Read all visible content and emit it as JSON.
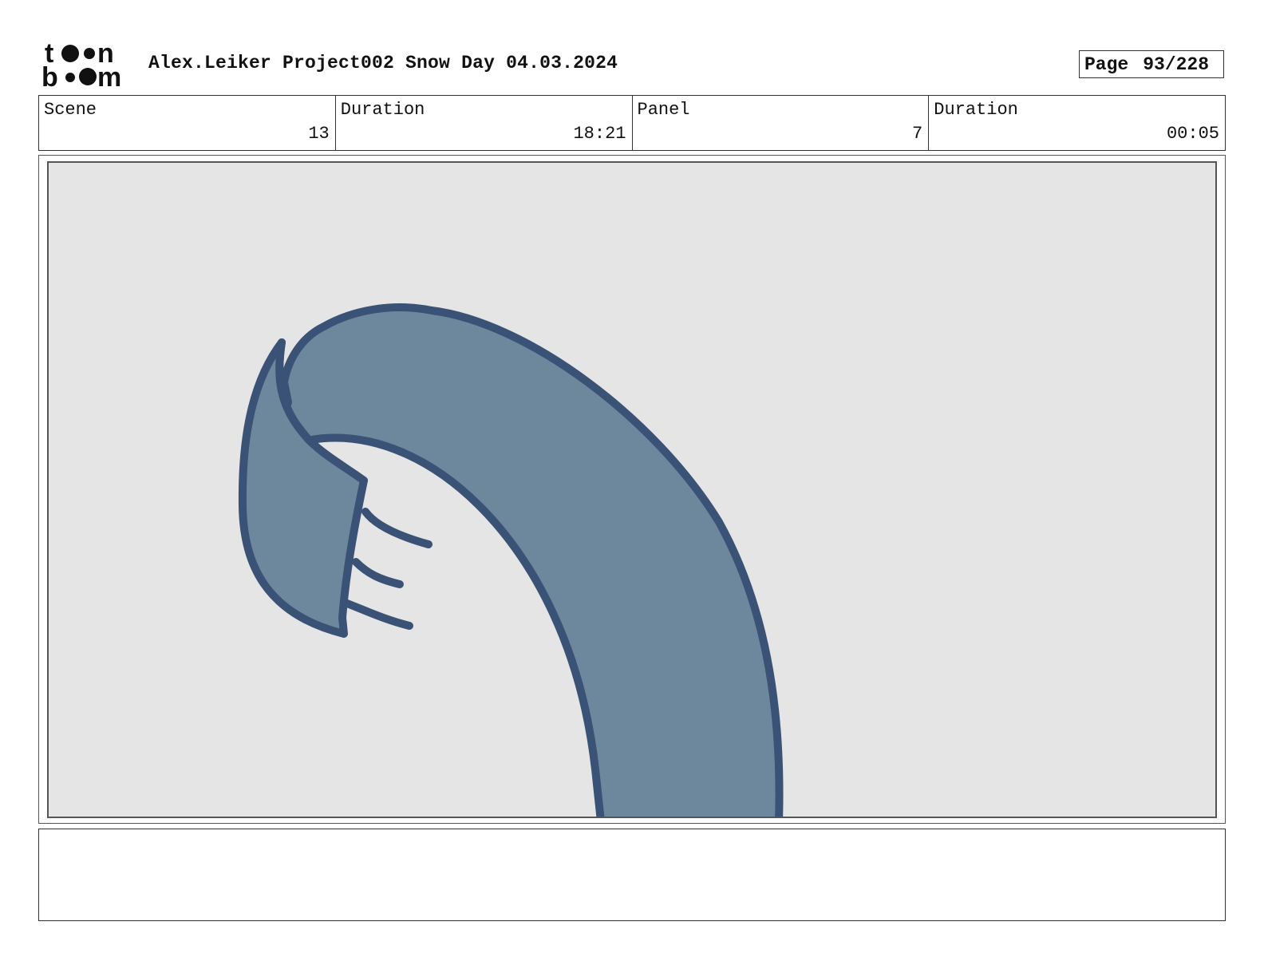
{
  "header": {
    "logo_alt": "toon boom",
    "title": "Alex.Leiker Project002 Snow Day 04.03.2024",
    "page_label": "Page",
    "page_value": "93/228"
  },
  "info": [
    {
      "label": "Scene",
      "value": "13"
    },
    {
      "label": "Duration",
      "value": "18:21"
    },
    {
      "label": "Panel",
      "value": "7"
    },
    {
      "label": "Duration",
      "value": "00:05"
    }
  ],
  "panel": {
    "background_color": "#e5e5e6",
    "fill_color": "#6d889d",
    "outline_color": "#3a5275"
  },
  "notes": {
    "text": ""
  }
}
